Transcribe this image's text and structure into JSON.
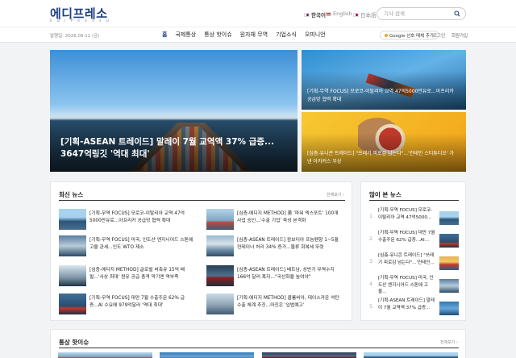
{
  "header": {
    "logo": "에디프레소",
    "logo_sub": "E D I P R E S S O",
    "languages": [
      {
        "label": "한국어",
        "flag": "kr-flag-icon"
      },
      {
        "label": "English",
        "flag": "us-flag-icon"
      },
      {
        "label": "日本語",
        "flag": "jp-flag-icon"
      }
    ],
    "search": {
      "placeholder": "기사 검색",
      "icon": "search-icon"
    }
  },
  "navbar": {
    "date": "발행일: 2026.09.11 (금)",
    "items": [
      "홈",
      "국제통상",
      "통상 핫이슈",
      "원자재 무역",
      "기업소식",
      "오피니언"
    ],
    "active": "홈",
    "subscribe": "Google 선호 매체 추가",
    "login": "로그인",
    "signup": "회원가입"
  },
  "hero": {
    "main_title": "[기획-ASEAN 트레이드] 말레이 7월 교역액 37% 급증... 3647억링깃 '역대 최대'",
    "side": [
      {
        "title": "[기획-무역 FOCUS] 모로코-이탈리아 교역 47억5000만유로...아프리카 공급망 협력 확대"
      },
      {
        "title": "[심층-유니콘 트레이드] \"쓰레기 피로감 넘는다\"...'컨테인 스티튜디오' 가낸 아카커스 부상"
      }
    ]
  },
  "latest": {
    "heading": "최신 뉴스",
    "more": "전체보기 ›",
    "left": [
      "[기획-무역 FOCUS] 모로코-이탈리아 교역 47억5000만유로...아프리카 공급망 협력 확대",
      "[기획-무역 FOCUS] 미국, 인도산 엔지니어드 스톤에 고율 관세...인도 WTO 제소",
      "[심층-에디지 METHOD] 글로벌 비축유 15억 배럴...'사상 최대' 원유 공급 충격 막기엔 역부족",
      "[기획-무역 FOCUS] 대만 7월 수출주문 62% 급증...AI 수요에 979억달러 '역대 최대'"
    ],
    "right": [
      "[심층-에디지 METHOD] 美 '파워 엑스포트' 100개 사업 승인...'수출 기업' 육성 본격화",
      "[심층-ASEAN 트레이드] 캄보디아 프놈펜항 1~5월 컨테이너 처리 34% 증가...물류 회복세 뚜렷",
      "[심층-ASEAN 트레이드] 베트남, 상반기 무역수지 166억 달러 흑자...\"국산화율 높여야\"",
      "[기획-에디지 METHOD] 콜롬비아, 데이스카운 석탄 수출 체계 추진...마진은 '입법예고'"
    ]
  },
  "popular": {
    "heading": "많이 본 뉴스",
    "items": [
      {
        "num": "1",
        "title": "[기획-무역 FOCUS] 모로코-이탈리아 교역 47억5000..."
      },
      {
        "num": "2",
        "title": "[기획-무역 FOCUS] 대만 7월 수출주문 62% 급증...AI..."
      },
      {
        "num": "3",
        "title": "[심층-유니콘 트레이드] \"쓰레기 피로감 넘는다\"...'컨테인..."
      },
      {
        "num": "4",
        "title": "[기획-무역 FOCUS] 미국, 인도산 엔지니어드 스톤에 고율..."
      },
      {
        "num": "5",
        "title": "[기획-ASEAN 트레이드] 말레이 7월 교역액 37% 급증..."
      }
    ]
  },
  "hot": {
    "heading": "통상 핫이슈",
    "more": "전체보기 ›"
  }
}
